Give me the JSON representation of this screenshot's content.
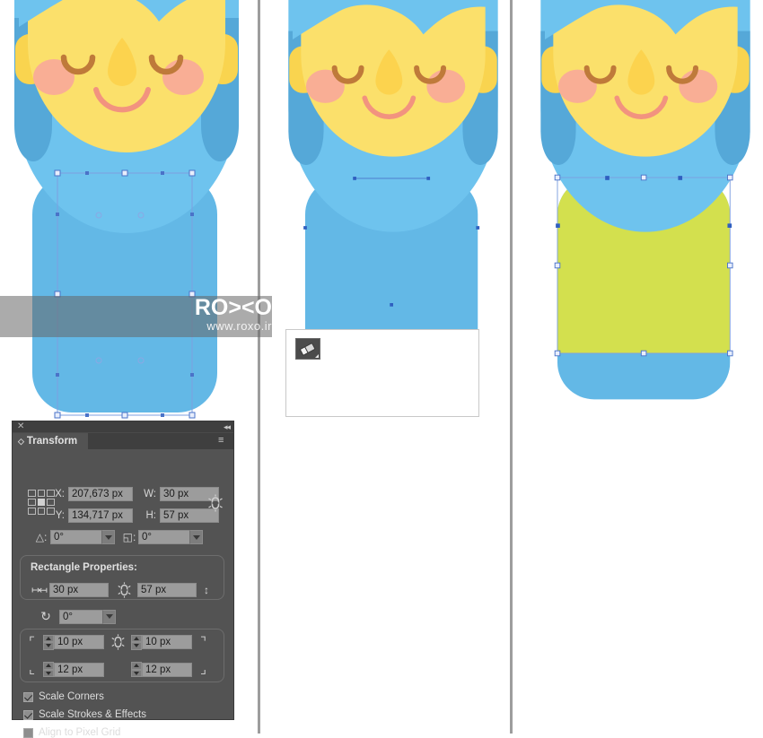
{
  "app": {
    "title": "Transform",
    "panel_close_label": "✕",
    "panel_collapse_label": "◂◂",
    "panel_menu_label": "≡"
  },
  "transform": {
    "title": "Transform",
    "reference_point": {
      "name": "reference-point-grid",
      "selected_index": 4,
      "cells": 9
    },
    "fields": {
      "x_label": "X:",
      "x_value": "207,673 px",
      "y_label": "Y:",
      "y_value": "134,717 px",
      "w_label": "W:",
      "w_value": "30 px",
      "h_label": "H:",
      "h_value": "57 px",
      "rotate_label": "△:",
      "rotate_value": "0°",
      "shear_label": "◱:",
      "shear_value": "0°",
      "constrain_wh_icon": "link-icon"
    },
    "rectangle_properties": {
      "title": "Rectangle Properties:",
      "width_icon": "width-arrow-icon",
      "width_value": "30 px",
      "height_icon": "height-arrow-icon",
      "height_value": "57 px",
      "constrain_icon": "link-icon",
      "angle_icon": "rotate-icon",
      "angle_value": "0°",
      "corners": {
        "constrain_icon": "link-icon",
        "top_left_icon": "corner-top-left-icon",
        "top_left_value": "10 px",
        "top_right_icon": "corner-top-right-icon",
        "top_right_value": "10 px",
        "bottom_left_icon": "corner-bottom-left-icon",
        "bottom_left_value": "12 px",
        "bottom_right_icon": "corner-bottom-right-icon",
        "bottom_right_value": "12 px"
      }
    },
    "checkboxes": [
      {
        "label": "Scale Corners",
        "checked": true
      },
      {
        "label": "Scale Strokes & Effects",
        "checked": true
      },
      {
        "label": "Align to Pixel Grid",
        "checked": false
      }
    ]
  },
  "watermark": {
    "title": "RO><O",
    "url": "www.roxo.ir"
  },
  "popup": {
    "tool_icon": "eraser-tool-icon"
  },
  "colors": {
    "body_blue": "#63b8e6",
    "hair_blue_light": "#6ec3ee",
    "hair_blue_dark": "#55a8d8",
    "face_yellow": "#fbe06b",
    "ear_yellow": "#f9d44f",
    "nose_yellow": "#fcd34e",
    "cheek_pink": "#f9ae95",
    "brow_brown": "#bf7a3a",
    "mouth_salmon": "#f2937f",
    "lime_green": "#d3e04e",
    "panel_bg": "#535353",
    "selection_blue": "#5b87d8",
    "divider_gray": "#9d9d9d"
  },
  "canvas": {
    "panel1_label": "figure-step-1",
    "panel2_label": "figure-step-2",
    "panel3_label": "figure-step-3"
  }
}
